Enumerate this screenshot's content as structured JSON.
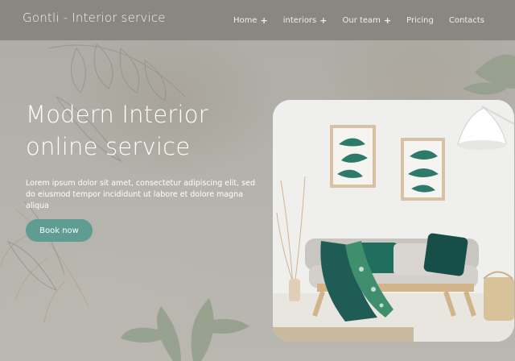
{
  "brand": {
    "name": "Gontli - Interior service"
  },
  "nav": {
    "items": [
      {
        "label": "Home",
        "has_submenu": true
      },
      {
        "label": "interiors",
        "has_submenu": true
      },
      {
        "label": "Our team",
        "has_submenu": true
      },
      {
        "label": "Pricing",
        "has_submenu": false
      },
      {
        "label": "Contacts",
        "has_submenu": false
      }
    ],
    "submenu_icon": "plus-icon",
    "submenu_glyph": "+"
  },
  "hero": {
    "title_line1": "Modern Interior",
    "title_line2": "online service",
    "text": "Lorem ipsum dolor sit amet, consectetur adipiscing elit, sed do eiusmod tempor incididunt ut labore et dolore magna aliqua",
    "button_label": "Book now"
  },
  "colors": {
    "header_bg": "#8a8680",
    "page_bg": "#b3b1aa",
    "button": "#5f9d92",
    "text": "#ffffff"
  },
  "image": {
    "subject": "living-room-photo"
  }
}
